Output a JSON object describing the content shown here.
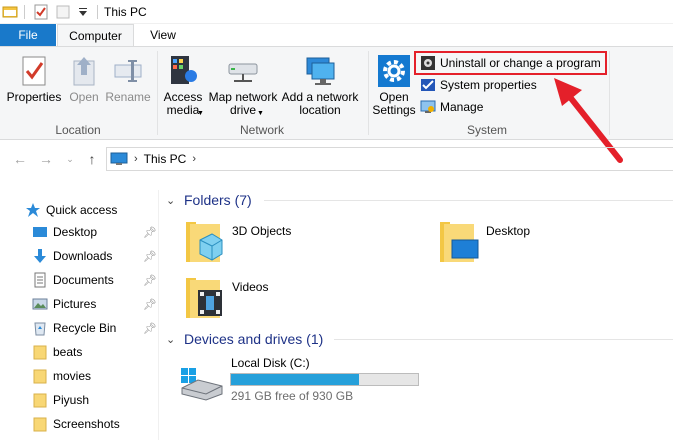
{
  "window": {
    "title": "This PC"
  },
  "tabs": {
    "file": "File",
    "computer": "Computer",
    "view": "View"
  },
  "ribbon": {
    "location": {
      "label": "Location",
      "buttons": [
        {
          "label": "Properties"
        },
        {
          "label": "Open"
        },
        {
          "label": "Rename"
        }
      ]
    },
    "network": {
      "label": "Network",
      "access_media": "Access\nmedia",
      "map_drive": "Map network\ndrive",
      "add_location": "Add a network\nlocation"
    },
    "system": {
      "label": "System",
      "open_settings": "Open\nSettings",
      "uninstall": "Uninstall or change a program",
      "system_properties": "System properties",
      "manage": "Manage"
    }
  },
  "address": {
    "crumb": "This PC"
  },
  "navpane": {
    "quick_access": "Quick access",
    "items": [
      {
        "label": "Desktop",
        "pinned": true
      },
      {
        "label": "Downloads",
        "pinned": true
      },
      {
        "label": "Documents",
        "pinned": true
      },
      {
        "label": "Pictures",
        "pinned": true
      },
      {
        "label": "Recycle Bin",
        "pinned": true
      },
      {
        "label": "beats",
        "pinned": false
      },
      {
        "label": "movies",
        "pinned": false
      },
      {
        "label": "Piyush",
        "pinned": false
      },
      {
        "label": "Screenshots",
        "pinned": false
      }
    ]
  },
  "content": {
    "folders_heading": "Folders (7)",
    "folders": [
      {
        "label": "3D Objects"
      },
      {
        "label": "Desktop"
      },
      {
        "label": "Videos"
      }
    ],
    "devices_heading": "Devices and drives (1)",
    "drive": {
      "name": "Local Disk (C:)",
      "free_text": "291 GB free of 930 GB",
      "used_fraction": 0.687
    }
  },
  "colors": {
    "accent": "#1979ca",
    "highlight": "#e4202a",
    "drive_fill": "#26a0da",
    "section_head": "#1e3287"
  }
}
